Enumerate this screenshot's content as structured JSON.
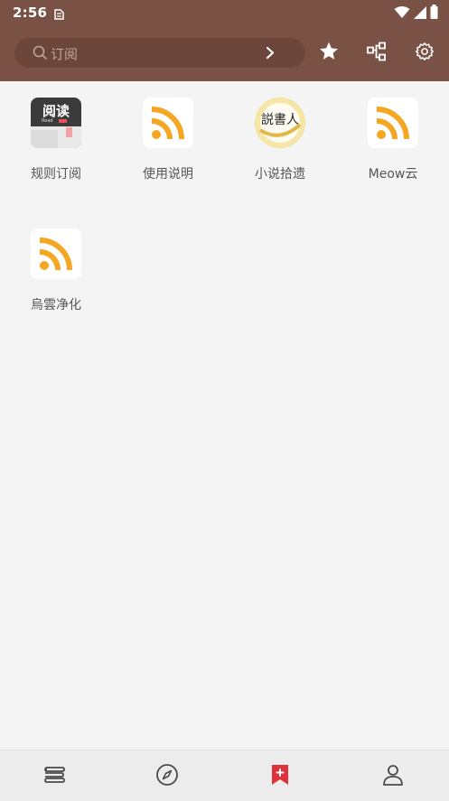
{
  "status_bar": {
    "time": "2:56"
  },
  "search": {
    "placeholder": "订阅"
  },
  "header_actions": {
    "star_icon": "star-icon",
    "group_icon": "group-icon",
    "settings_icon": "gear-icon"
  },
  "subscriptions": [
    {
      "label": "规则订阅",
      "icon": "app-read-icon"
    },
    {
      "label": "使用说明",
      "icon": "rss-icon"
    },
    {
      "label": "小说拾遗",
      "icon": "novel-logo-icon"
    },
    {
      "label": "Meow云",
      "icon": "rss-icon"
    },
    {
      "label": "烏雲净化",
      "icon": "rss-icon"
    }
  ],
  "read_icon_text": {
    "top": "阅读",
    "sub": "Read"
  },
  "novel_icon_text": "説書人",
  "bottom_nav": {
    "items": [
      {
        "icon": "bookshelf-icon"
      },
      {
        "icon": "compass-icon"
      },
      {
        "icon": "bookmark-plus-icon",
        "active": true
      },
      {
        "icon": "person-icon"
      }
    ]
  },
  "colors": {
    "header": "#7a5245",
    "active_tab": "#e0323a",
    "rss_orange": "#f5a623"
  }
}
